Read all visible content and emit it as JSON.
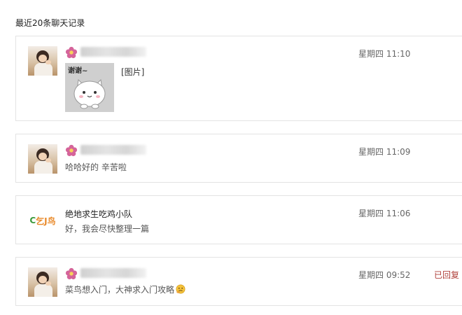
{
  "page": {
    "heading": "最近20条聊天记录"
  },
  "conversations": [
    {
      "sender_kind": "user",
      "message_prefix": "",
      "message_label": "[图片]",
      "sticker_text": "谢谢~",
      "time": "星期四 11:10",
      "status": ""
    },
    {
      "sender_kind": "user",
      "message": "哈哈好的 辛苦啦",
      "time": "星期四 11:09",
      "status": ""
    },
    {
      "sender_kind": "group",
      "name": "绝地求生吃鸡小队",
      "avatar_text_green": "C",
      "avatar_text_orange": "乞J鸟",
      "message": "好，我会尽快整理一篇",
      "time": "星期四 11:06",
      "status": ""
    },
    {
      "sender_kind": "user",
      "message": "菜鸟想入门，大神求入门攻略",
      "time": "星期四 09:52",
      "status": "已回复"
    }
  ],
  "icons": {
    "profile_badge": "flower-icon",
    "emoji": "thinking-emoji-icon"
  },
  "colors": {
    "replied_status": "#b0403a",
    "flower": "#d5649a",
    "group_logo_green": "#3b9a3b",
    "group_logo_orange": "#e98a2a"
  }
}
